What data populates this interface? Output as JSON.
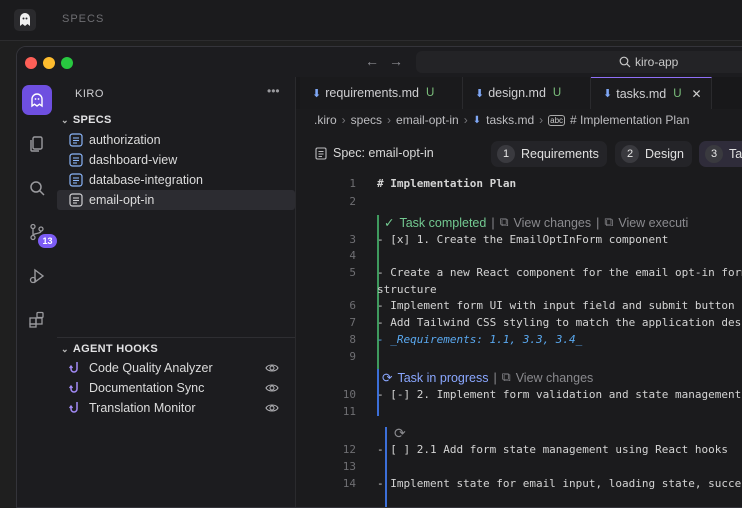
{
  "outer": {
    "label": "SPECS"
  },
  "titlebar": {
    "search": "kiro-app"
  },
  "activity": {
    "source_control_badge": "13"
  },
  "sidebar": {
    "title": "KIRO",
    "more": "•••",
    "specs_header": "SPECS",
    "specs": [
      {
        "label": "authorization"
      },
      {
        "label": "dashboard-view"
      },
      {
        "label": "database-integration"
      },
      {
        "label": "email-opt-in"
      }
    ],
    "hooks_header": "AGENT HOOKS",
    "hooks": [
      {
        "label": "Code Quality Analyzer"
      },
      {
        "label": "Documentation Sync"
      },
      {
        "label": "Translation Monitor"
      }
    ]
  },
  "tabs": [
    {
      "name": "requirements.md",
      "mark": "U"
    },
    {
      "name": "design.md",
      "mark": "U"
    },
    {
      "name": "tasks.md",
      "mark": "U",
      "close": "✕"
    }
  ],
  "breadcrumb": {
    "parts": [
      ".kiro",
      "specs",
      "email-opt-in",
      "tasks.md"
    ],
    "heading": "# Implementation Plan"
  },
  "spec": {
    "label": "Spec: email-opt-in",
    "steps": [
      {
        "num": "1",
        "label": "Requirements"
      },
      {
        "num": "2",
        "label": "Design"
      },
      {
        "num": "3",
        "label": "Task"
      }
    ]
  },
  "task_ui": {
    "completed": "Task completed",
    "view_changes": "View changes",
    "view_execution": "View executi",
    "in_progress": "Task in progress",
    "view_changes_2": "View changes"
  },
  "code": {
    "l1": "# Implementation Plan",
    "l3": "- [x] 1. Create the EmailOptInForm component",
    "l5a": "  - Create a new React component for the email opt-in form",
    "l5b": "structure",
    "l6": "  - Implement form UI with input field and submit button",
    "l7": "  - Add Tailwind CSS styling to match the application design",
    "l8": "  - _Requirements: 1.1, 3.3, 3.4_",
    "l10": "- [-] 2. Implement form validation and state management",
    "l12": "  - [ ] 2.1 Add form state management using React hooks",
    "l14": "    - Implement state for email input, loading state, success"
  },
  "line_numbers": [
    "1",
    "2",
    "3",
    "4",
    "5",
    "6",
    "7",
    "8",
    "9",
    "10",
    "11",
    "12",
    "13",
    "14"
  ]
}
